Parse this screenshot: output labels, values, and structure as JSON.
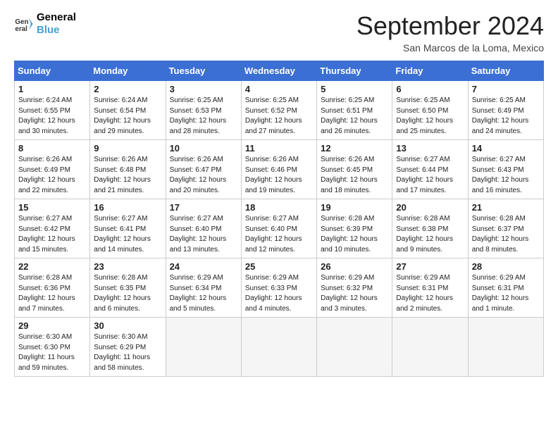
{
  "header": {
    "logo_line1": "General",
    "logo_line2": "Blue",
    "month_title": "September 2024",
    "location": "San Marcos de la Loma, Mexico"
  },
  "weekdays": [
    "Sunday",
    "Monday",
    "Tuesday",
    "Wednesday",
    "Thursday",
    "Friday",
    "Saturday"
  ],
  "weeks": [
    [
      {
        "day": "1",
        "sunrise": "6:24 AM",
        "sunset": "6:55 PM",
        "daylight": "12 hours and 30 minutes."
      },
      {
        "day": "2",
        "sunrise": "6:24 AM",
        "sunset": "6:54 PM",
        "daylight": "12 hours and 29 minutes."
      },
      {
        "day": "3",
        "sunrise": "6:25 AM",
        "sunset": "6:53 PM",
        "daylight": "12 hours and 28 minutes."
      },
      {
        "day": "4",
        "sunrise": "6:25 AM",
        "sunset": "6:52 PM",
        "daylight": "12 hours and 27 minutes."
      },
      {
        "day": "5",
        "sunrise": "6:25 AM",
        "sunset": "6:51 PM",
        "daylight": "12 hours and 26 minutes."
      },
      {
        "day": "6",
        "sunrise": "6:25 AM",
        "sunset": "6:50 PM",
        "daylight": "12 hours and 25 minutes."
      },
      {
        "day": "7",
        "sunrise": "6:25 AM",
        "sunset": "6:49 PM",
        "daylight": "12 hours and 24 minutes."
      }
    ],
    [
      {
        "day": "8",
        "sunrise": "6:26 AM",
        "sunset": "6:49 PM",
        "daylight": "12 hours and 22 minutes."
      },
      {
        "day": "9",
        "sunrise": "6:26 AM",
        "sunset": "6:48 PM",
        "daylight": "12 hours and 21 minutes."
      },
      {
        "day": "10",
        "sunrise": "6:26 AM",
        "sunset": "6:47 PM",
        "daylight": "12 hours and 20 minutes."
      },
      {
        "day": "11",
        "sunrise": "6:26 AM",
        "sunset": "6:46 PM",
        "daylight": "12 hours and 19 minutes."
      },
      {
        "day": "12",
        "sunrise": "6:26 AM",
        "sunset": "6:45 PM",
        "daylight": "12 hours and 18 minutes."
      },
      {
        "day": "13",
        "sunrise": "6:27 AM",
        "sunset": "6:44 PM",
        "daylight": "12 hours and 17 minutes."
      },
      {
        "day": "14",
        "sunrise": "6:27 AM",
        "sunset": "6:43 PM",
        "daylight": "12 hours and 16 minutes."
      }
    ],
    [
      {
        "day": "15",
        "sunrise": "6:27 AM",
        "sunset": "6:42 PM",
        "daylight": "12 hours and 15 minutes."
      },
      {
        "day": "16",
        "sunrise": "6:27 AM",
        "sunset": "6:41 PM",
        "daylight": "12 hours and 14 minutes."
      },
      {
        "day": "17",
        "sunrise": "6:27 AM",
        "sunset": "6:40 PM",
        "daylight": "12 hours and 13 minutes."
      },
      {
        "day": "18",
        "sunrise": "6:27 AM",
        "sunset": "6:40 PM",
        "daylight": "12 hours and 12 minutes."
      },
      {
        "day": "19",
        "sunrise": "6:28 AM",
        "sunset": "6:39 PM",
        "daylight": "12 hours and 10 minutes."
      },
      {
        "day": "20",
        "sunrise": "6:28 AM",
        "sunset": "6:38 PM",
        "daylight": "12 hours and 9 minutes."
      },
      {
        "day": "21",
        "sunrise": "6:28 AM",
        "sunset": "6:37 PM",
        "daylight": "12 hours and 8 minutes."
      }
    ],
    [
      {
        "day": "22",
        "sunrise": "6:28 AM",
        "sunset": "6:36 PM",
        "daylight": "12 hours and 7 minutes."
      },
      {
        "day": "23",
        "sunrise": "6:28 AM",
        "sunset": "6:35 PM",
        "daylight": "12 hours and 6 minutes."
      },
      {
        "day": "24",
        "sunrise": "6:29 AM",
        "sunset": "6:34 PM",
        "daylight": "12 hours and 5 minutes."
      },
      {
        "day": "25",
        "sunrise": "6:29 AM",
        "sunset": "6:33 PM",
        "daylight": "12 hours and 4 minutes."
      },
      {
        "day": "26",
        "sunrise": "6:29 AM",
        "sunset": "6:32 PM",
        "daylight": "12 hours and 3 minutes."
      },
      {
        "day": "27",
        "sunrise": "6:29 AM",
        "sunset": "6:31 PM",
        "daylight": "12 hours and 2 minutes."
      },
      {
        "day": "28",
        "sunrise": "6:29 AM",
        "sunset": "6:31 PM",
        "daylight": "12 hours and 1 minute."
      }
    ],
    [
      {
        "day": "29",
        "sunrise": "6:30 AM",
        "sunset": "6:30 PM",
        "daylight": "11 hours and 59 minutes."
      },
      {
        "day": "30",
        "sunrise": "6:30 AM",
        "sunset": "6:29 PM",
        "daylight": "11 hours and 58 minutes."
      },
      null,
      null,
      null,
      null,
      null
    ]
  ]
}
